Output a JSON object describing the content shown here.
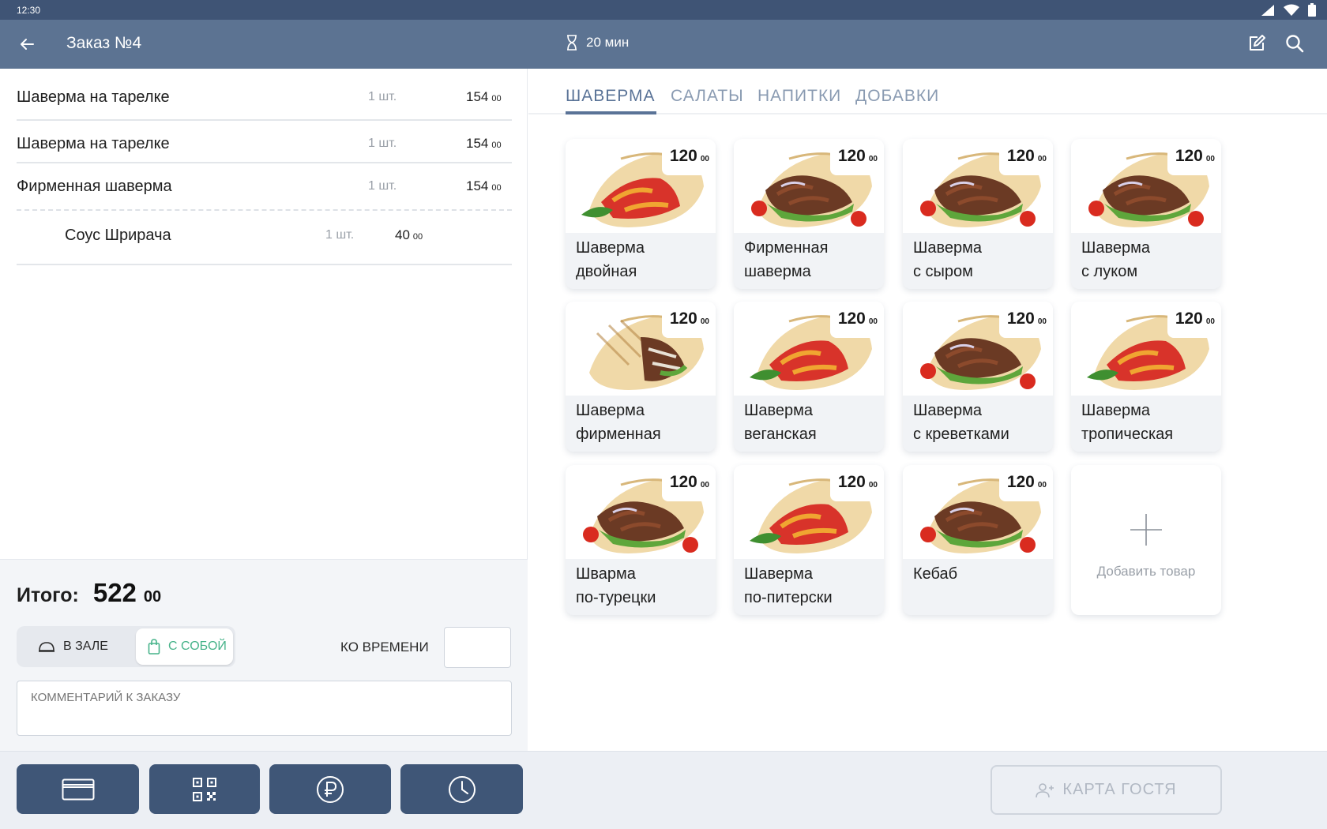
{
  "status_bar": {
    "time": "12:30"
  },
  "header": {
    "title": "Заказ №4",
    "timer": "20 мин"
  },
  "order": {
    "items": [
      {
        "name": "Шаверма на тарелке",
        "qty": "1 шт.",
        "price": "154",
        "cents": "00"
      },
      {
        "name": "Шаверма на тарелке",
        "qty": "1 шт.",
        "price": "154",
        "cents": "00"
      },
      {
        "name": "Фирменная шаверма",
        "qty": "1 шт.",
        "price": "154",
        "cents": "00"
      }
    ],
    "modifier": {
      "name": "Соус Шрирача",
      "qty": "1 шт.",
      "price": "40",
      "cents": "00"
    }
  },
  "summary": {
    "total_label": "Итого:",
    "total_amount": "522",
    "total_cents": "00",
    "mode_hall": "В ЗАЛЕ",
    "mode_takeaway": "С СОБОЙ",
    "selected_mode": "С СОБОЙ",
    "on_time_label": "КО ВРЕМЕНИ",
    "on_time_value": "",
    "comment_placeholder": "КОММЕНТАРИЙ К ЗАКАЗУ"
  },
  "tabs": [
    "ШАВЕРМА",
    "САЛАТЫ",
    "НАПИТКИ",
    "ДОБАВКИ"
  ],
  "active_tab": "ШАВЕРМА",
  "products": [
    {
      "line1": "Шаверма",
      "line2": "двойная",
      "price": "120",
      "cents": "00",
      "image": "wrap-veggie"
    },
    {
      "line1": "Фирменная",
      "line2": "шаверма",
      "price": "120",
      "cents": "00",
      "image": "wrap-meat"
    },
    {
      "line1": "Шаверма",
      "line2": "с сыром",
      "price": "120",
      "cents": "00",
      "image": "wrap-meat"
    },
    {
      "line1": "Шаверма",
      "line2": "с луком",
      "price": "120",
      "cents": "00",
      "image": "wrap-meat"
    },
    {
      "line1": "Шаверма",
      "line2": "фирменная",
      "price": "120",
      "cents": "00",
      "image": "wrap-grilled"
    },
    {
      "line1": "Шаверма",
      "line2": "веганская",
      "price": "120",
      "cents": "00",
      "image": "wrap-veggie"
    },
    {
      "line1": "Шаверма",
      "line2": "с креветками",
      "price": "120",
      "cents": "00",
      "image": "wrap-meat"
    },
    {
      "line1": "Шаверма",
      "line2": "тропическая",
      "price": "120",
      "cents": "00",
      "image": "wrap-veggie"
    },
    {
      "line1": "Шварма",
      "line2": "по-турецки",
      "price": "120",
      "cents": "00",
      "image": "wrap-meat"
    },
    {
      "line1": "Шаверма",
      "line2": "по-питерски",
      "price": "120",
      "cents": "00",
      "image": "wrap-veggie"
    },
    {
      "line1": "Кебаб",
      "line2": "",
      "price": "120",
      "cents": "00",
      "image": "wrap-meat"
    }
  ],
  "add_product_label": "Добавить товар",
  "bottom": {
    "buttons": [
      "credit-card-icon",
      "qr-code-icon",
      "ruble-icon",
      "clock-icon"
    ],
    "guest_card_label": "КАРТА ГОСТЯ"
  },
  "colors": {
    "app_bar": "#5c7392",
    "status_bar": "#3f5475",
    "action_button": "#3f5677",
    "accent_takeaway": "#47b38a",
    "tab_active": "#5a7397"
  }
}
